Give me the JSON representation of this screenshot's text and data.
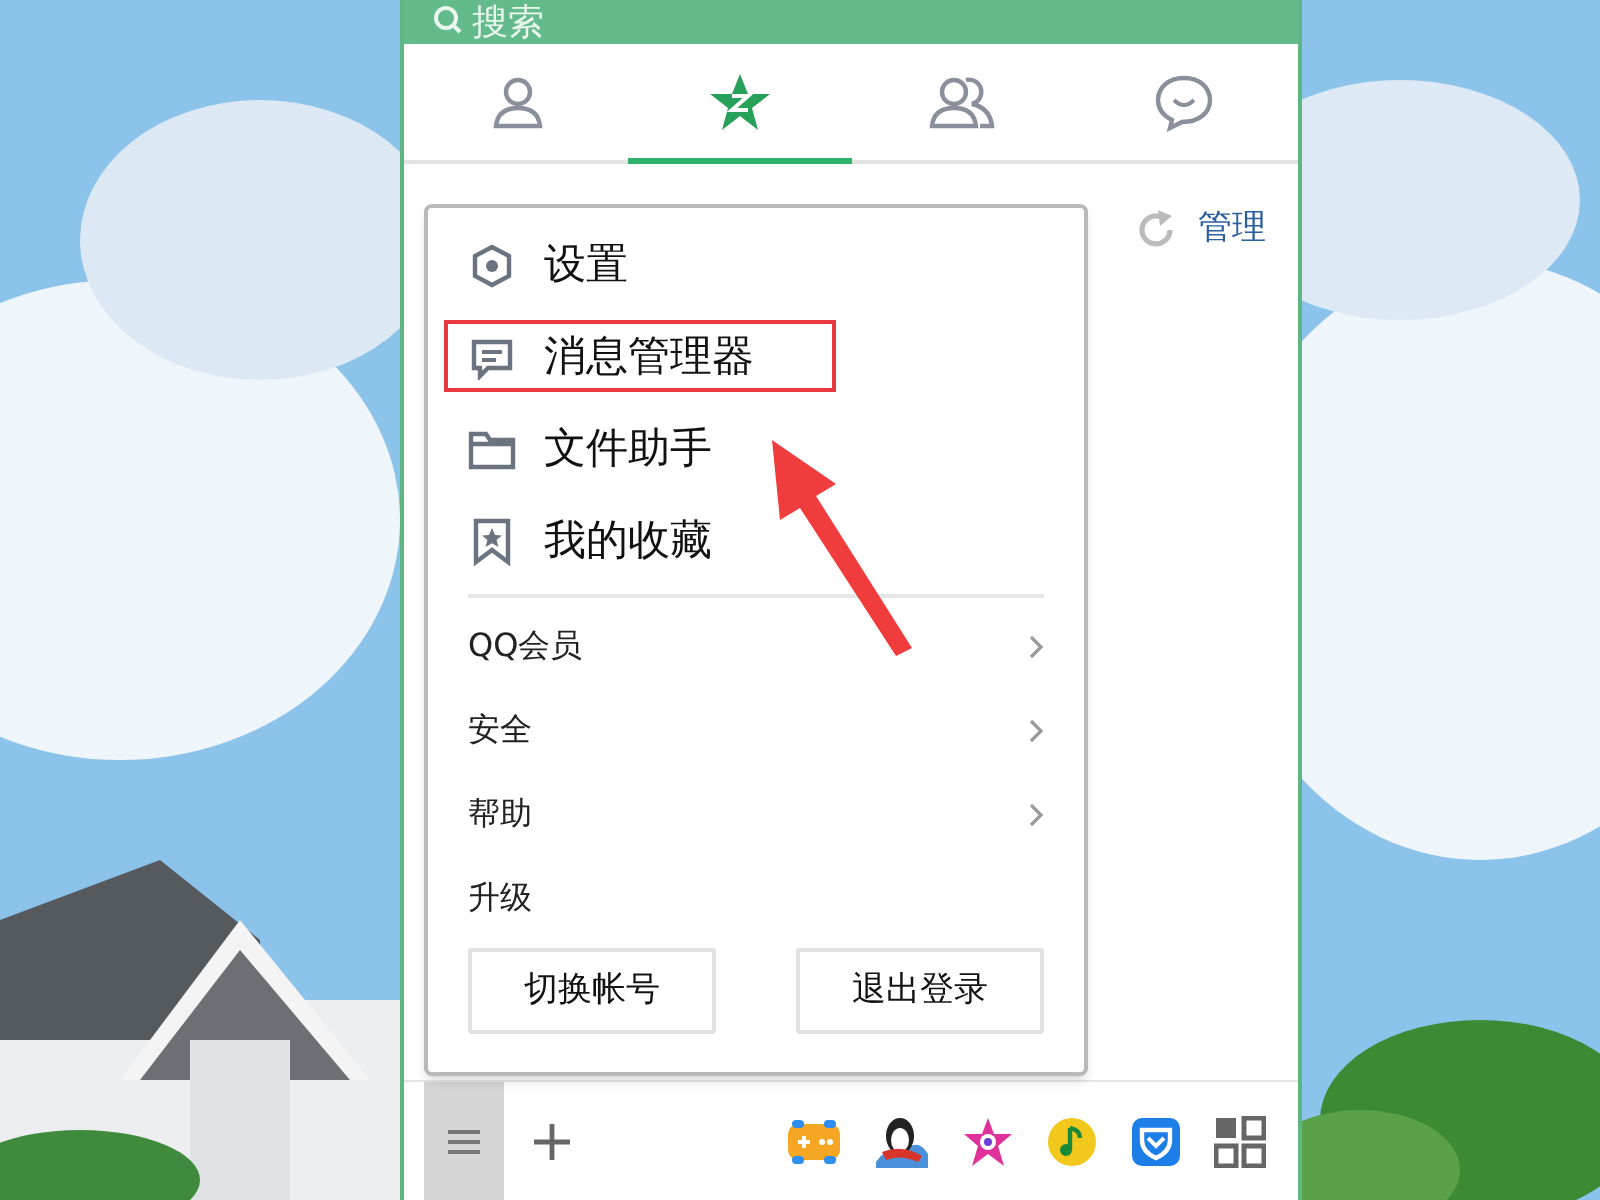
{
  "search": {
    "placeholder": "搜索"
  },
  "tabs": [
    {
      "kind": "contact",
      "selected": false
    },
    {
      "kind": "qzone",
      "selected": true
    },
    {
      "kind": "group",
      "selected": false
    },
    {
      "kind": "chat",
      "selected": false
    }
  ],
  "manage": {
    "label": "管理"
  },
  "menu": {
    "items": [
      {
        "kind": "large",
        "label": "设置",
        "highlighted": false
      },
      {
        "kind": "large",
        "label": "消息管理器",
        "highlighted": true
      },
      {
        "kind": "large",
        "label": "文件助手",
        "highlighted": false
      },
      {
        "kind": "large",
        "label": "我的收藏",
        "highlighted": false
      },
      {
        "kind": "submenu",
        "label": "QQ会员"
      },
      {
        "kind": "submenu",
        "label": "安全"
      },
      {
        "kind": "submenu",
        "label": "帮助"
      },
      {
        "kind": "plain",
        "label": "升级"
      }
    ],
    "buttons": [
      "切换帐号",
      "退出登录"
    ]
  },
  "annotation": {
    "arrow": true
  },
  "bottom_bar": {
    "apps": [
      {
        "kind": "game"
      },
      {
        "kind": "penguin"
      },
      {
        "kind": "star"
      },
      {
        "kind": "music"
      },
      {
        "kind": "shield"
      },
      {
        "kind": "grid"
      }
    ]
  }
}
